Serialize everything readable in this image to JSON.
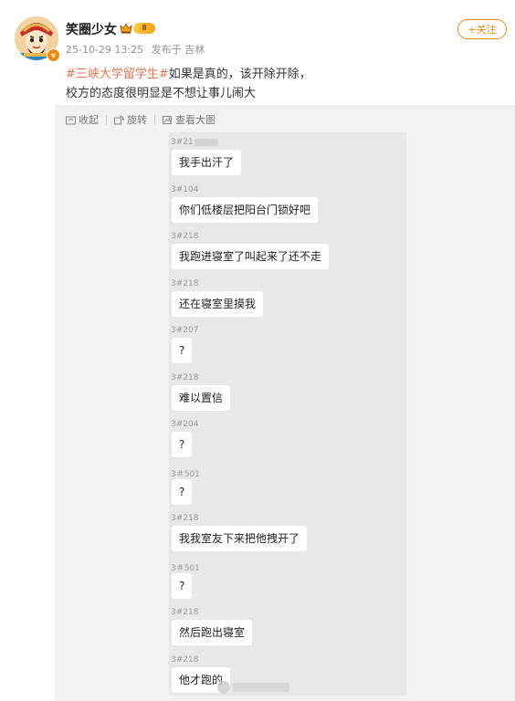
{
  "post": {
    "username": "笑圈少女",
    "vip_level": "Ⅱ",
    "timestamp": "25-10-29 13:25",
    "source": "发布于 吉林",
    "follow_label": "+关注",
    "hashtag": "#三峡大学留学生#",
    "text_line1": "如果是真的，该开除开除，",
    "text_line2": "校方的态度很明显是不想让事儿闹大"
  },
  "toolbar": {
    "collapse_label": "收起",
    "rotate_label": "旋转",
    "view_large_label": "查看大图"
  },
  "chat": {
    "messages": [
      {
        "sender": "3#21",
        "text": "我手出汗了",
        "sender_blurred": true
      },
      {
        "sender": "3#104",
        "text": "你们低楼层把阳台门锁好吧"
      },
      {
        "sender": "3#218",
        "text": "我跑进寝室了叫起来了还不走"
      },
      {
        "sender": "3#218",
        "text": "还在寝室里摸我"
      },
      {
        "sender": "3#207",
        "text": "?"
      },
      {
        "sender": "3#218",
        "text": "难以置信"
      },
      {
        "sender": "3#204",
        "text": "?"
      },
      {
        "sender": "3＃501",
        "text": "?"
      },
      {
        "sender": "3#218",
        "text": "我我室友下来把他拽开了"
      },
      {
        "sender": "3＃501",
        "text": "?"
      },
      {
        "sender": "3#218",
        "text": "然后跑出寝室"
      },
      {
        "sender": "3#218",
        "text": "他才跑的"
      }
    ]
  },
  "colors": {
    "accent_orange": "#f08a0a",
    "hashtag": "#eb7350",
    "meta_gray": "#939393"
  },
  "icons": [
    "crown-icon",
    "collapse-icon",
    "rotate-icon",
    "view-large-icon"
  ]
}
